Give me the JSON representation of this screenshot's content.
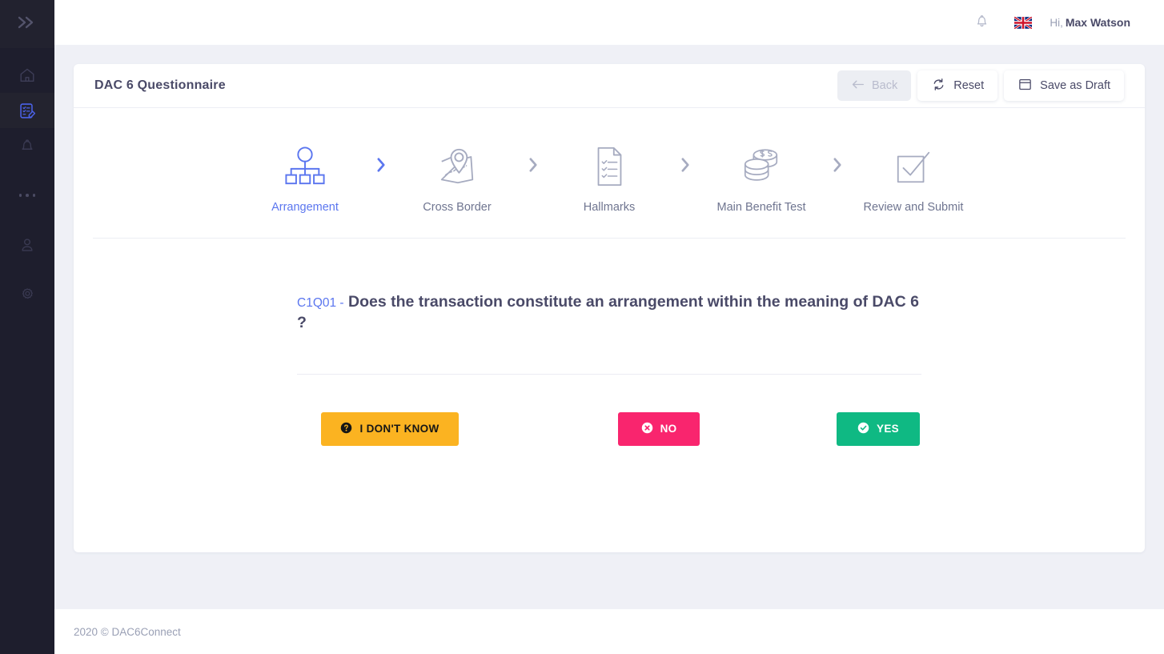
{
  "sidebar": {
    "toggle": {
      "icon": "double-chevron-right-icon"
    },
    "items": [
      {
        "id": "home",
        "icon": "home-icon",
        "active": false
      },
      {
        "id": "forms",
        "icon": "form-edit-icon",
        "active": true
      },
      {
        "id": "alerts",
        "icon": "bell-icon",
        "active": false
      },
      {
        "id": "more",
        "icon": "more-dots-icon",
        "active": false
      },
      {
        "id": "profile",
        "icon": "user-icon",
        "active": false
      },
      {
        "id": "settings",
        "icon": "gear-icon",
        "active": false
      }
    ]
  },
  "topbar": {
    "notifications_icon": "bell-icon",
    "language_flag": "uk-flag-icon",
    "greeting_prefix": "Hi,",
    "user_name": "Max Watson"
  },
  "card": {
    "title": "DAC 6 Questionnaire",
    "actions": [
      {
        "id": "back",
        "label": "Back",
        "icon": "arrow-left-icon",
        "disabled": true
      },
      {
        "id": "reset",
        "label": "Reset",
        "icon": "refresh-icon",
        "disabled": false
      },
      {
        "id": "save-as-draft",
        "label": "Save as Draft",
        "icon": "save-icon",
        "disabled": false
      }
    ]
  },
  "stepper": {
    "steps": [
      {
        "id": "arrangement",
        "label": "Arrangement",
        "icon": "org-chart-icon",
        "active": true
      },
      {
        "id": "cross-border",
        "label": "Cross Border",
        "icon": "map-pin-icon",
        "active": false
      },
      {
        "id": "hallmarks",
        "label": "Hallmarks",
        "icon": "checklist-doc-icon",
        "active": false
      },
      {
        "id": "main-benefit-test",
        "label": "Main Benefit Test",
        "icon": "coins-stack-icon",
        "active": false
      },
      {
        "id": "review-submit",
        "label": "Review and Submit",
        "icon": "checkbox-check-icon",
        "active": false
      }
    ],
    "separator_icon": "chevron-right-icon"
  },
  "question": {
    "code": "C1Q01 -",
    "text": "Does the transaction constitute an arrangement within the meaning of DAC 6 ?"
  },
  "answers": [
    {
      "id": "dont-know",
      "label": "I DON'T KNOW",
      "icon": "question-circle-icon",
      "color": "#FBB321"
    },
    {
      "id": "no",
      "label": "NO",
      "icon": "x-circle-icon",
      "color": "#F9256E"
    },
    {
      "id": "yes",
      "label": "YES",
      "icon": "check-circle-icon",
      "color": "#0FB983"
    }
  ],
  "footer": {
    "text": "2020 © DAC6Connect"
  },
  "colors": {
    "accent_blue": "#5B76EF",
    "sidebar_bg": "#1E1E2D",
    "page_bg": "#EFF0F6",
    "text_dark": "#4A4A68",
    "text_muted": "#9AA0B5"
  }
}
